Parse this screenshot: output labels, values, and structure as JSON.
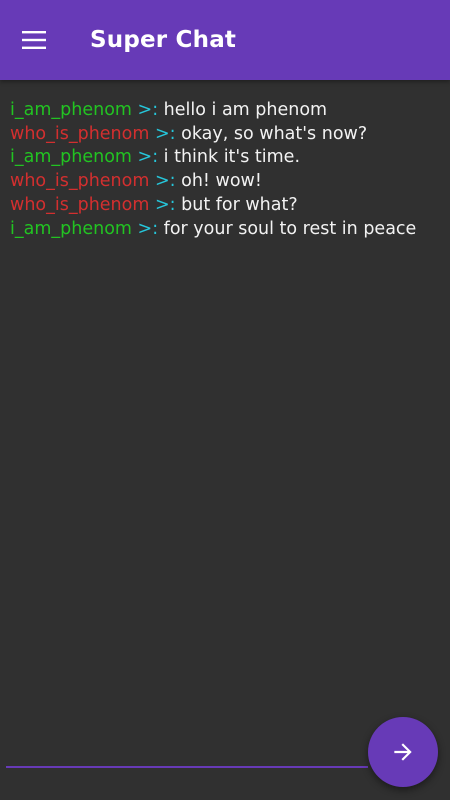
{
  "app": {
    "title": "Super Chat",
    "menu_icon": "menu-icon",
    "accent_color": "#673ab7"
  },
  "users": {
    "i_am_phenom": {
      "color": "#22c322"
    },
    "who_is_phenom": {
      "color": "#d32f2f"
    }
  },
  "messages": [
    {
      "user": "i_am_phenom",
      "separator": ">:",
      "text": "hello i am phenom"
    },
    {
      "user": "who_is_phenom",
      "separator": ">:",
      "text": "okay, so what's now?"
    },
    {
      "user": "i_am_phenom",
      "separator": ">:",
      "text": "i think it's time."
    },
    {
      "user": "who_is_phenom",
      "separator": ">:",
      "text": "oh! wow!"
    },
    {
      "user": "who_is_phenom",
      "separator": ">:",
      "text": "but for what?"
    },
    {
      "user": "i_am_phenom",
      "separator": ">:",
      "text": "for your soul to rest in peace"
    }
  ],
  "composer": {
    "value": "",
    "placeholder": "",
    "send_icon": "arrow-right-icon"
  }
}
